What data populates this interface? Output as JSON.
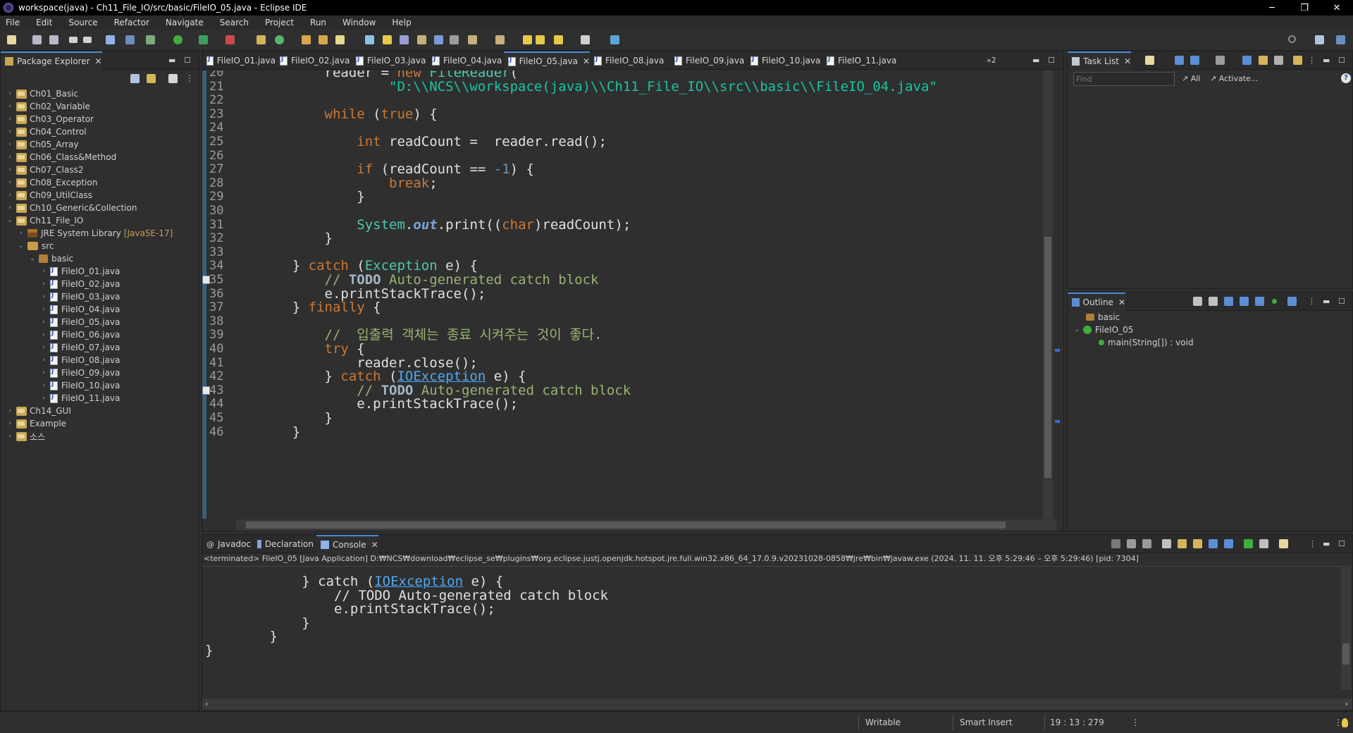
{
  "window": {
    "title": "workspace(java) - Ch11_File_IO/src/basic/FileIO_05.java - Eclipse IDE",
    "minimize": "─",
    "restore": "❐",
    "close": "✕"
  },
  "menu": [
    "File",
    "Edit",
    "Source",
    "Refactor",
    "Navigate",
    "Search",
    "Project",
    "Run",
    "Window",
    "Help"
  ],
  "package_explorer": {
    "tab_label": "Package Explorer",
    "items": [
      {
        "label": "Ch01_Basic",
        "indent": 0,
        "kind": "project",
        "arrow": "›"
      },
      {
        "label": "Ch02_Variable",
        "indent": 0,
        "kind": "project",
        "arrow": "›"
      },
      {
        "label": "Ch03_Operator",
        "indent": 0,
        "kind": "project",
        "arrow": "›"
      },
      {
        "label": "Ch04_Control",
        "indent": 0,
        "kind": "project",
        "arrow": "›"
      },
      {
        "label": "Ch05_Array",
        "indent": 0,
        "kind": "project",
        "arrow": "›"
      },
      {
        "label": "Ch06_Class&Method",
        "indent": 0,
        "kind": "project",
        "arrow": "›"
      },
      {
        "label": "Ch07_Class2",
        "indent": 0,
        "kind": "project",
        "arrow": "›"
      },
      {
        "label": "Ch08_Exception",
        "indent": 0,
        "kind": "project",
        "arrow": "›"
      },
      {
        "label": "Ch09_UtilClass",
        "indent": 0,
        "kind": "project",
        "arrow": "›"
      },
      {
        "label": "Ch10_Generic&Collection",
        "indent": 0,
        "kind": "project",
        "arrow": "›"
      },
      {
        "label": "Ch11_File_IO",
        "indent": 0,
        "kind": "project",
        "arrow": "⌄"
      },
      {
        "label": "JRE System Library",
        "suffix": "[JavaSE-17]",
        "indent": 1,
        "kind": "lib",
        "arrow": "›"
      },
      {
        "label": "src",
        "indent": 1,
        "kind": "src",
        "arrow": "⌄"
      },
      {
        "label": "basic",
        "indent": 2,
        "kind": "pkg",
        "arrow": "⌄"
      },
      {
        "label": "FileIO_01.java",
        "indent": 3,
        "kind": "java",
        "arrow": "›"
      },
      {
        "label": "FileIO_02.java",
        "indent": 3,
        "kind": "java",
        "arrow": "›"
      },
      {
        "label": "FileIO_03.java",
        "indent": 3,
        "kind": "java",
        "arrow": "›"
      },
      {
        "label": "FileIO_04.java",
        "indent": 3,
        "kind": "java",
        "arrow": "›"
      },
      {
        "label": "FileIO_05.java",
        "indent": 3,
        "kind": "java",
        "arrow": "›"
      },
      {
        "label": "FileIO_06.java",
        "indent": 3,
        "kind": "java",
        "arrow": "›"
      },
      {
        "label": "FileIO_07.java",
        "indent": 3,
        "kind": "java",
        "arrow": "›"
      },
      {
        "label": "FileIO_08.java",
        "indent": 3,
        "kind": "java",
        "arrow": "›"
      },
      {
        "label": "FileIO_09.java",
        "indent": 3,
        "kind": "java",
        "arrow": "›"
      },
      {
        "label": "FileIO_10.java",
        "indent": 3,
        "kind": "java",
        "arrow": "›"
      },
      {
        "label": "FileIO_11.java",
        "indent": 3,
        "kind": "java",
        "arrow": "›"
      },
      {
        "label": "Ch14_GUI",
        "indent": 0,
        "kind": "project",
        "arrow": "›"
      },
      {
        "label": "Example",
        "indent": 0,
        "kind": "project",
        "arrow": "›"
      },
      {
        "label": "소스",
        "indent": 0,
        "kind": "project",
        "arrow": "›"
      }
    ]
  },
  "editor": {
    "tabs": [
      {
        "label": "FileIO_01.java",
        "active": false
      },
      {
        "label": "FileIO_02.java",
        "active": false
      },
      {
        "label": "FileIO_03.java",
        "active": false
      },
      {
        "label": "FileIO_04.java",
        "active": false
      },
      {
        "label": "FileIO_05.java",
        "active": true
      },
      {
        "label": "FileIO_08.java",
        "active": false
      },
      {
        "label": "FileIO_09.java",
        "active": false
      },
      {
        "label": "FileIO_10.java",
        "active": false
      },
      {
        "label": "FileIO_11.java",
        "active": false
      }
    ],
    "overflow": "»2",
    "lines": [
      {
        "n": "20",
        "code": "        reader = new FileReader("
      },
      {
        "n": "21",
        "code": "                \"D:\\\\NCS\\\\workspace(java)\\\\Ch11_File_IO\\\\src\\\\basic\\\\FileIO_04.java\""
      },
      {
        "n": "22",
        "code": ""
      },
      {
        "n": "23",
        "code": "        while (true) {"
      },
      {
        "n": "24",
        "code": ""
      },
      {
        "n": "25",
        "code": "            int readCount =  reader.read();"
      },
      {
        "n": "26",
        "code": ""
      },
      {
        "n": "27",
        "code": "            if (readCount == -1) {"
      },
      {
        "n": "28",
        "code": "                break;"
      },
      {
        "n": "29",
        "code": "            }"
      },
      {
        "n": "30",
        "code": ""
      },
      {
        "n": "31",
        "code": "            System.out.print((char)readCount);"
      },
      {
        "n": "32",
        "code": "        }"
      },
      {
        "n": "33",
        "code": ""
      },
      {
        "n": "34",
        "code": "    } catch (Exception e) {"
      },
      {
        "n": "35",
        "code": "        // TODO Auto-generated catch block"
      },
      {
        "n": "36",
        "code": "        e.printStackTrace();"
      },
      {
        "n": "37",
        "code": "    } finally {"
      },
      {
        "n": "38",
        "code": ""
      },
      {
        "n": "39",
        "code": "        //  입출력 객체는 종료 시켜주는 것이 좋다."
      },
      {
        "n": "40",
        "code": "        try {"
      },
      {
        "n": "41",
        "code": "            reader.close();"
      },
      {
        "n": "42",
        "code": "        } catch (IOException e) {"
      },
      {
        "n": "43",
        "code": "            // TODO Auto-generated catch block"
      },
      {
        "n": "44",
        "code": "            e.printStackTrace();"
      },
      {
        "n": "45",
        "code": "        }"
      },
      {
        "n": "46",
        "code": "    }"
      }
    ]
  },
  "task_list": {
    "tab_label": "Task List",
    "find_placeholder": "Find",
    "all_label": "All",
    "activate_label": "Activate..."
  },
  "outline": {
    "tab_label": "Outline",
    "items": [
      "basic",
      "FileIO_05",
      "main(String[]) : void"
    ]
  },
  "bottom": {
    "tabs": [
      "Javadoc",
      "Declaration",
      "Console"
    ],
    "terminated": "<terminated> FileIO_05 [Java Application] D:₩NCS₩download₩eclipse_se₩plugins₩org.eclipse.justj.openjdk.hotspot.jre.full.win32.x86_64_17.0.9.v20231028-0858₩jre₩bin₩javaw.exe  (2024. 11. 11. 오후 5:29:46 – 오후 5:29:46) [pid: 7304]",
    "console_lines": [
      "            } catch (IOException e) {",
      "                // TODO Auto-generated catch block",
      "                e.printStackTrace();",
      "            }",
      "        }",
      "}"
    ]
  },
  "status": {
    "writable": "Writable",
    "insert_mode": "Smart Insert",
    "position": "19 : 13 : 279"
  },
  "colors": {
    "accent": "#4a8cd6",
    "keyword": "#cc7832",
    "type": "#4ec9b0",
    "string": "#17c6a3",
    "comment": "#98b373"
  }
}
